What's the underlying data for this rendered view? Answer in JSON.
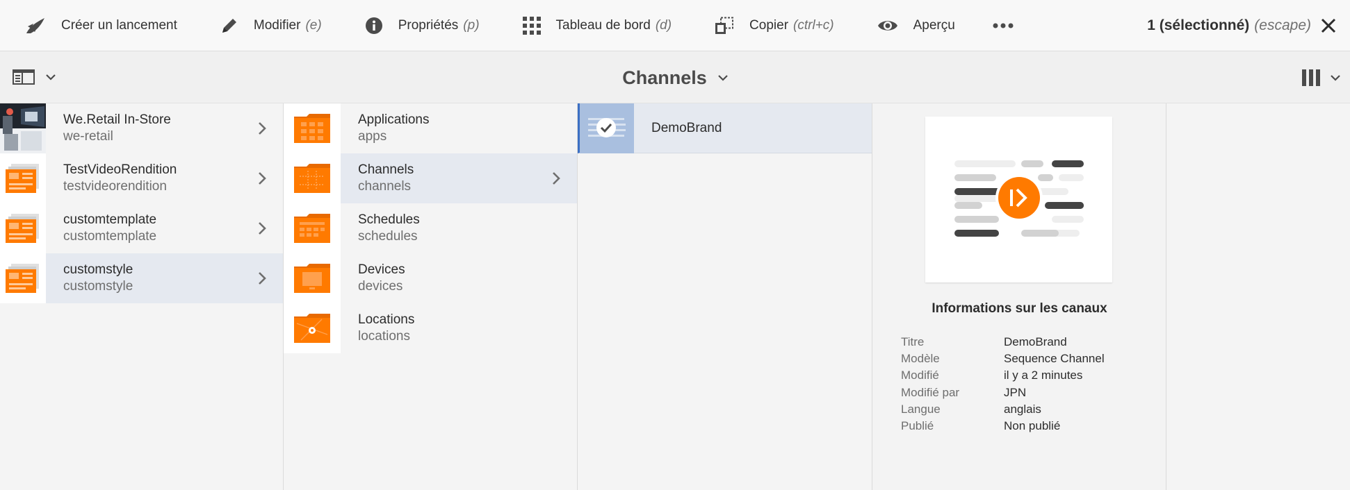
{
  "toolbar": {
    "create_launch": "Créer un lancement",
    "edit": "Modifier",
    "edit_key": "(e)",
    "properties": "Propriétés",
    "properties_key": "(p)",
    "dashboard": "Tableau de bord",
    "dashboard_key": "(d)",
    "copy": "Copier",
    "copy_key": "(ctrl+c)",
    "preview": "Aperçu",
    "selection": "1 (sélectionné)",
    "selection_key": "(escape)"
  },
  "header": {
    "title": "Channels"
  },
  "column1": [
    {
      "title": "We.Retail In-Store",
      "subtitle": "we-retail",
      "thumb": "photo"
    },
    {
      "title": "TestVideoRendition",
      "subtitle": "testvideorendition",
      "thumb": "template"
    },
    {
      "title": "customtemplate",
      "subtitle": "customtemplate",
      "thumb": "template"
    },
    {
      "title": "customstyle",
      "subtitle": "customstyle",
      "thumb": "template"
    }
  ],
  "column2": [
    {
      "title": "Applications",
      "subtitle": "apps"
    },
    {
      "title": "Channels",
      "subtitle": "channels"
    },
    {
      "title": "Schedules",
      "subtitle": "schedules"
    },
    {
      "title": "Devices",
      "subtitle": "devices"
    },
    {
      "title": "Locations",
      "subtitle": "locations"
    }
  ],
  "column3": [
    {
      "title": "DemoBrand"
    }
  ],
  "info": {
    "title": "Informations sur les canaux",
    "rows": [
      {
        "key": "Titre",
        "value": "DemoBrand"
      },
      {
        "key": "Modèle",
        "value": "Sequence Channel"
      },
      {
        "key": "Modifié",
        "value": "il y a 2 minutes"
      },
      {
        "key": "Modifié par",
        "value": "JPN"
      },
      {
        "key": "Langue",
        "value": "anglais"
      },
      {
        "key": "Publié",
        "value": "Non publié"
      }
    ]
  },
  "colors": {
    "accent": "#ff7a00",
    "selection": "#e5e9f0",
    "selection_border": "#3b6fc4"
  },
  "icons": [
    "rocket-icon",
    "pencil-icon",
    "info-icon",
    "grid-icon",
    "copy-icon",
    "eye-icon",
    "more-icon",
    "close-icon",
    "rail-icon",
    "chevron-down-icon",
    "column-view-icon",
    "chevron-right-icon",
    "check-icon",
    "play-icon"
  ]
}
